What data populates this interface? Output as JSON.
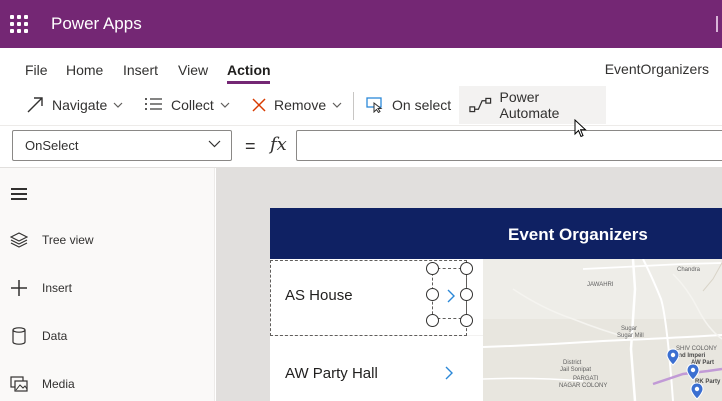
{
  "app": {
    "title": "Power Apps",
    "name": "EventOrganizers"
  },
  "menu": {
    "tabs": [
      {
        "label": "File"
      },
      {
        "label": "Home"
      },
      {
        "label": "Insert"
      },
      {
        "label": "View"
      },
      {
        "label": "Action",
        "active": true
      }
    ]
  },
  "toolbar": {
    "navigate": "Navigate",
    "collect": "Collect",
    "remove": "Remove",
    "on_select": "On select",
    "power_automate": "Power Automate"
  },
  "formula": {
    "property": "OnSelect",
    "equals": "=",
    "fx": "fx",
    "value": ""
  },
  "sidebar": {
    "items": [
      {
        "label": "Tree view",
        "icon": "layers-icon"
      },
      {
        "label": "Insert",
        "icon": "plus-icon"
      },
      {
        "label": "Data",
        "icon": "database-icon"
      },
      {
        "label": "Media",
        "icon": "media-icon"
      }
    ]
  },
  "screen": {
    "title": "Event Organizers",
    "list": [
      {
        "label": "AS House",
        "selected": true
      },
      {
        "label": "AW Party Hall"
      }
    ],
    "map_labels": {
      "jawahri": "JAWAHRI",
      "sugar_mill": "Sugar Mill",
      "sugar": "Sugar",
      "district": "District",
      "jail_sonipat": "Jail Sonipat",
      "pargati": "PARGATI",
      "nagar_colony": "NAGAR COLONY",
      "shiv_colony": "SHIV COLONY",
      "grand_imperial": "Grand Imperi",
      "aw_party": "AW Part",
      "rk_party": "RK Party H",
      "chandra": "Chandra"
    }
  },
  "colors": {
    "brand": "#742774",
    "screen_header": "#0f2163",
    "list_chevron": "#2b88d8",
    "map_pin": "#3b6fd1"
  }
}
